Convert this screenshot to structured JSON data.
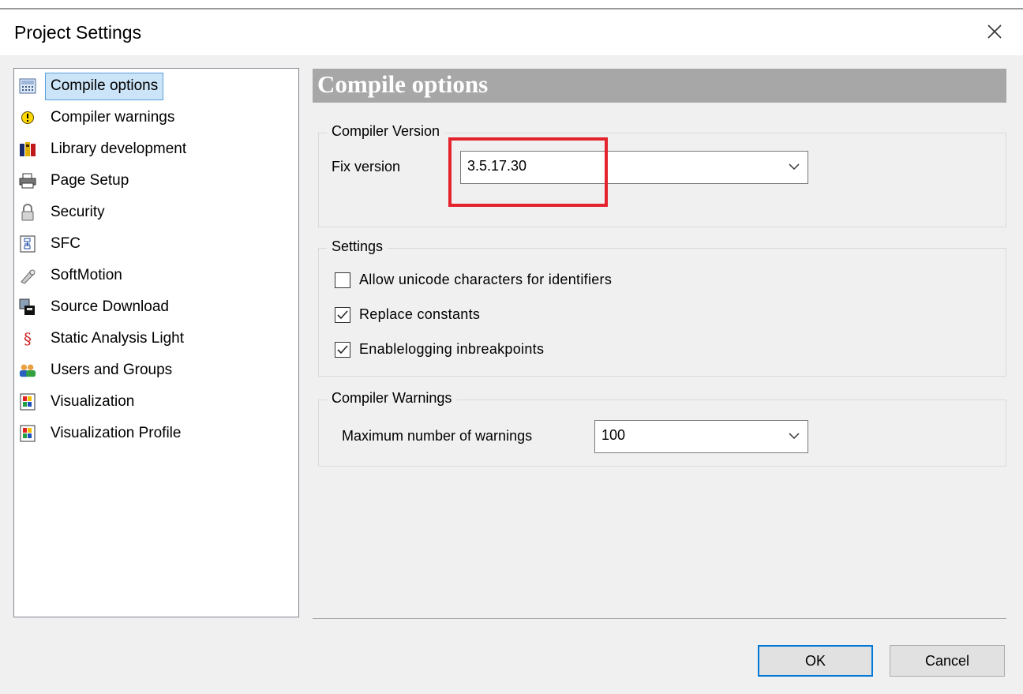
{
  "window": {
    "title": "Project Settings"
  },
  "nav": {
    "items": [
      {
        "label": "Compile options",
        "icon": "compile-options-icon",
        "selected": true
      },
      {
        "label": "Compiler warnings",
        "icon": "warning-icon"
      },
      {
        "label": "Library development",
        "icon": "library-books-icon"
      },
      {
        "label": "Page Setup",
        "icon": "printer-icon"
      },
      {
        "label": "Security",
        "icon": "lock-icon"
      },
      {
        "label": "SFC",
        "icon": "sfc-icon"
      },
      {
        "label": "SoftMotion",
        "icon": "softmotion-icon"
      },
      {
        "label": "Source Download",
        "icon": "source-download-icon"
      },
      {
        "label": "Static Analysis Light",
        "icon": "section-sign-icon"
      },
      {
        "label": "Users and Groups",
        "icon": "users-icon"
      },
      {
        "label": "Visualization",
        "icon": "visualization-icon"
      },
      {
        "label": "Visualization Profile",
        "icon": "visualization-profile-icon"
      }
    ]
  },
  "panel": {
    "header": "Compile options",
    "compiler_version": {
      "legend": "Compiler Version",
      "fix_label": "Fix version",
      "fix_value": "3.5.17.30"
    },
    "settings": {
      "legend": "Settings",
      "options": [
        {
          "label": "Allow unicode characters for identifiers",
          "checked": false
        },
        {
          "label": "Replace constants",
          "checked": true
        },
        {
          "label": "Enablelogging inbreakpoints",
          "checked": true
        }
      ]
    },
    "compiler_warnings": {
      "legend": "Compiler Warnings",
      "max_label": "Maximum number of warnings",
      "max_value": "100"
    }
  },
  "buttons": {
    "ok": "OK",
    "cancel": "Cancel"
  },
  "colors": {
    "highlight": "#e4232d",
    "selection": "#cce4f7",
    "header": "#a7a7a7"
  }
}
